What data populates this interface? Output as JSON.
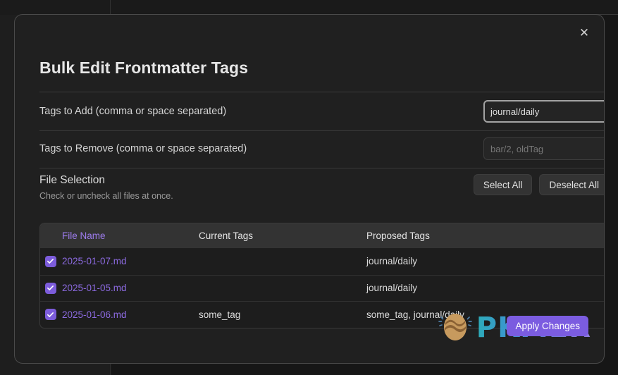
{
  "dialog": {
    "title": "Bulk Edit Frontmatter Tags",
    "close_label": "✕",
    "close_icon": "close-icon"
  },
  "settings": [
    {
      "name": "Tags to Add (comma or space separated)",
      "value": "journal/daily",
      "placeholder": "",
      "focused": true
    },
    {
      "name": "Tags to Remove (comma or space separated)",
      "value": "",
      "placeholder": "bar/2, oldTag",
      "focused": false
    }
  ],
  "file_selection": {
    "heading": "File Selection",
    "description": "Check or uncheck all files at once.",
    "select_all_label": "Select All",
    "deselect_all_label": "Deselect All"
  },
  "table": {
    "headers": [
      "File Name",
      "Current Tags",
      "Proposed Tags"
    ],
    "rows": [
      {
        "checked": true,
        "file_name": "2025-01-07.md",
        "current_tags": "",
        "proposed_tags": "journal/daily"
      },
      {
        "checked": true,
        "file_name": "2025-01-05.md",
        "current_tags": "",
        "proposed_tags": "journal/daily"
      },
      {
        "checked": true,
        "file_name": "2025-01-06.md",
        "current_tags": "some_tag",
        "proposed_tags": "some_tag, journal/daily"
      }
    ]
  },
  "footer": {
    "apply_label": "Apply Changes"
  },
  "watermark": {
    "text": "PKMER",
    "icon": "egg-logo-icon"
  },
  "colors": {
    "accent_purple": "#7b5ce0",
    "link_purple": "#8c6ae0",
    "dialog_bg": "#202020",
    "table_header_bg": "#333333"
  }
}
